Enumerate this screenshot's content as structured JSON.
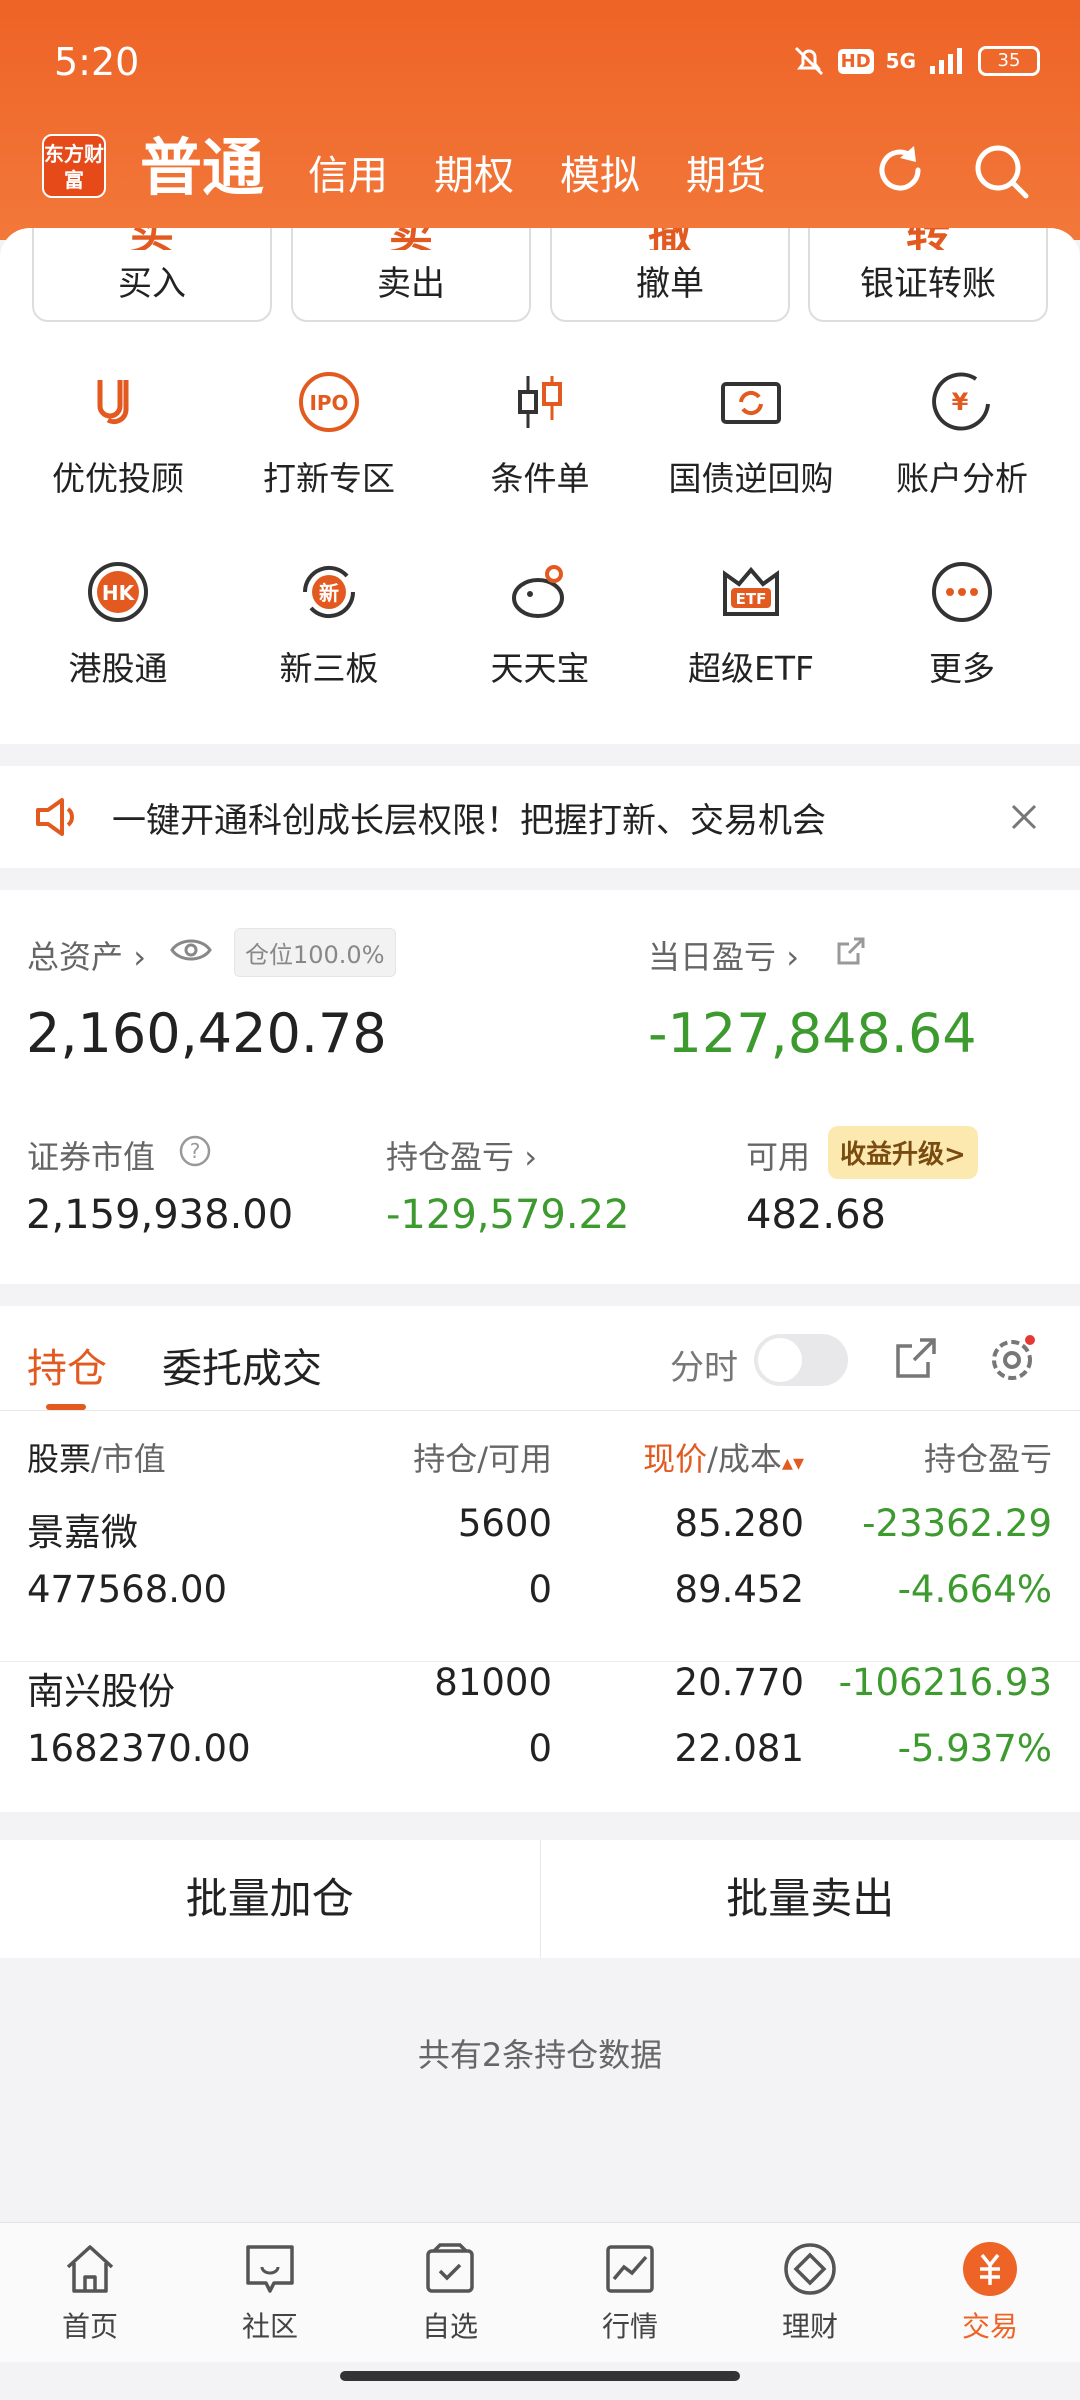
{
  "status_bar": {
    "time": "5:20",
    "hd": "HD",
    "network": "5G",
    "battery": "35"
  },
  "header": {
    "logo": "东方财富",
    "tabs": [
      "普通",
      "信用",
      "期权",
      "模拟",
      "期货"
    ]
  },
  "quick_actions": [
    {
      "glyph": "买",
      "label": "买入"
    },
    {
      "glyph": "卖",
      "label": "卖出"
    },
    {
      "glyph": "撤",
      "label": "撤单"
    },
    {
      "glyph": "转",
      "label": "银证转账"
    }
  ],
  "grid": [
    {
      "label": "优优投顾",
      "icon": "uu-advisor-icon"
    },
    {
      "label": "打新专区",
      "icon": "ipo-icon",
      "icon_text": "IPO"
    },
    {
      "label": "条件单",
      "icon": "candlestick-icon"
    },
    {
      "label": "国债逆回购",
      "icon": "bond-repo-icon"
    },
    {
      "label": "账户分析",
      "icon": "account-analysis-icon",
      "icon_text": "¥"
    },
    {
      "label": "港股通",
      "icon": "hk-icon",
      "icon_text": "HK"
    },
    {
      "label": "新三板",
      "icon": "new-board-icon",
      "icon_text": "新"
    },
    {
      "label": "天天宝",
      "icon": "piggy-icon"
    },
    {
      "label": "超级ETF",
      "icon": "etf-icon",
      "icon_text": "ETF"
    },
    {
      "label": "更多",
      "icon": "more-icon"
    }
  ],
  "notice": {
    "text": "一键开通科创成长层权限！把握打新、交易机会"
  },
  "account": {
    "total_label": "总资产",
    "position_label": "仓位100.0%",
    "total_value": "2,160,420.78",
    "daily_label": "当日盈亏",
    "daily_value": "-127,848.64",
    "mv_label": "证券市值",
    "mv_value": "2,159,938.00",
    "hold_pl_label": "持仓盈亏",
    "hold_pl_value": "-129,579.22",
    "avail_label": "可用",
    "upgrade_label": "收益升级>",
    "avail_value": "482.68"
  },
  "holdings": {
    "tabs": [
      "持仓",
      "委托成交"
    ],
    "timeshare_label": "分时",
    "col_stock": "股票",
    "col_mv": "/市值",
    "col_pos": "持仓/可用",
    "col_price": "现价",
    "col_cost": "/成本",
    "col_pl": "持仓盈亏",
    "rows": [
      {
        "name": "景嘉微",
        "market_value": "477568.00",
        "position": "5600",
        "available": "0",
        "price": "85.280",
        "cost": "89.452",
        "pl": "-23362.29",
        "pl_pct": "-4.664%"
      },
      {
        "name": "南兴股份",
        "market_value": "1682370.00",
        "position": "81000",
        "available": "0",
        "price": "20.770",
        "cost": "22.081",
        "pl": "-106216.93",
        "pl_pct": "-5.937%"
      }
    ]
  },
  "batch": {
    "add": "批量加仓",
    "sell": "批量卖出"
  },
  "summary": "共有2条持仓数据",
  "nav": [
    "首页",
    "社区",
    "自选",
    "行情",
    "理财",
    "交易"
  ],
  "nav_active": "交易",
  "colors": {
    "accent": "#ee6326",
    "loss": "#3c9a2e"
  }
}
